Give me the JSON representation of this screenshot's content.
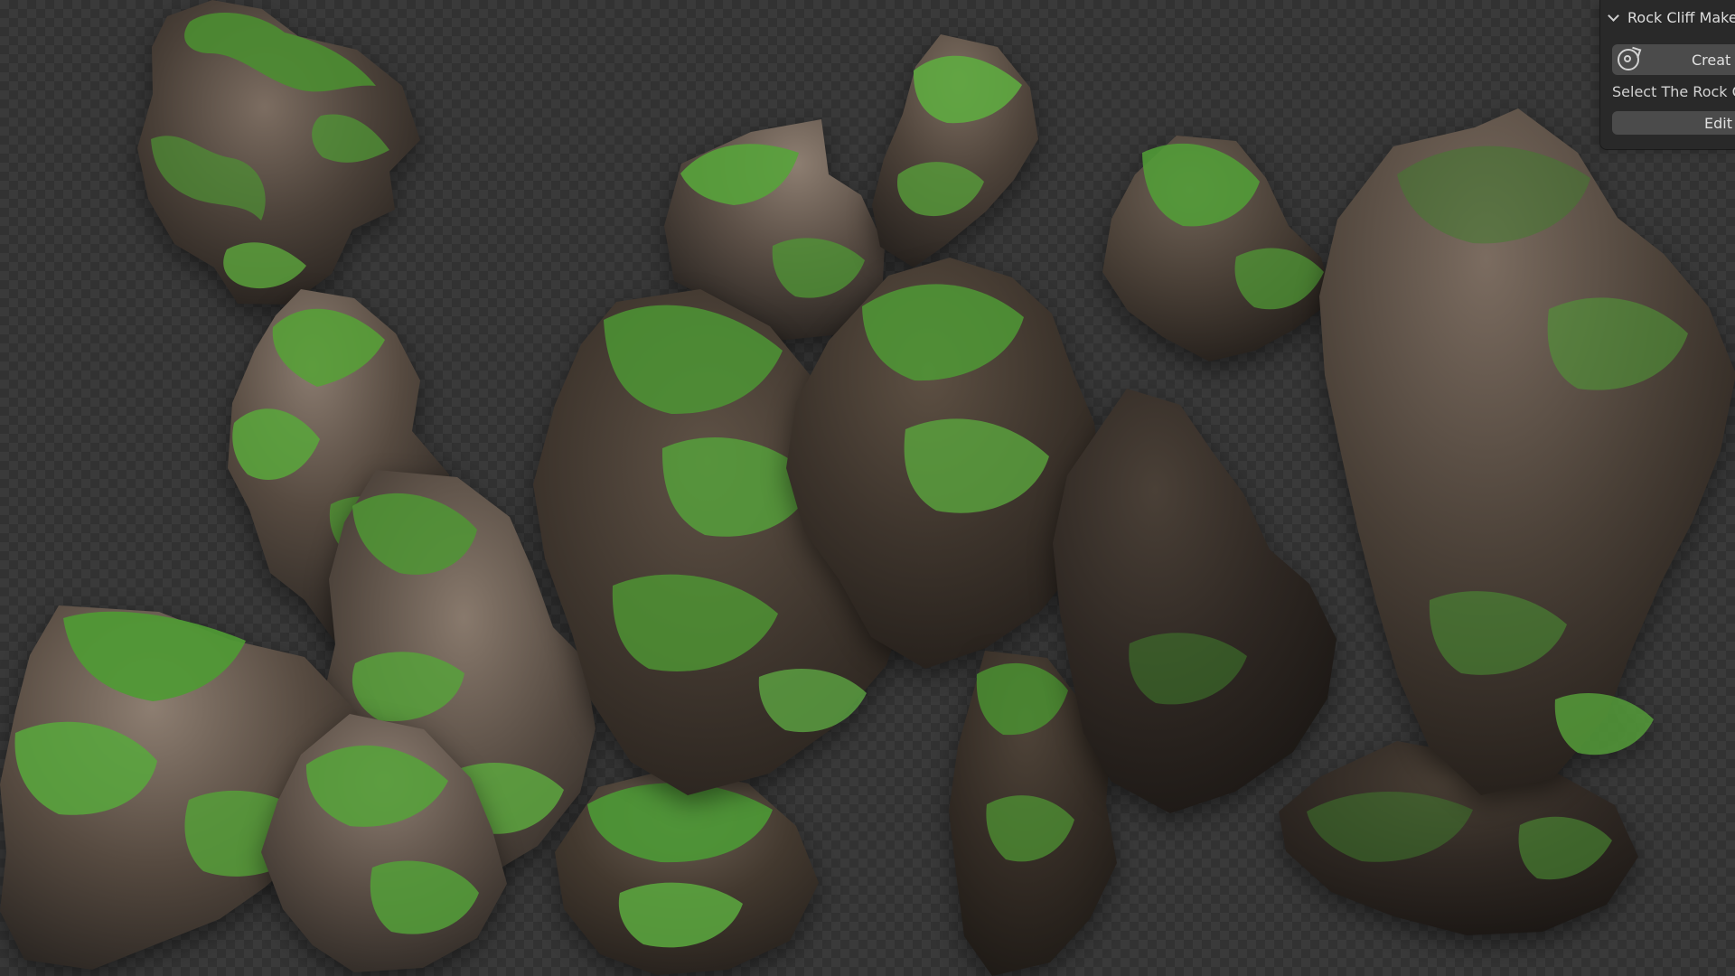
{
  "panel": {
    "title": "Rock Cliff Maker",
    "create_label": "Creat",
    "instruction": "Select The Rock Cl",
    "edit_label": "Edit"
  },
  "colors": {
    "viewport_dark": "#323232",
    "viewport_light": "#3a3a3a",
    "panel_background": "#282828",
    "button_background": "#4b4b4b"
  }
}
